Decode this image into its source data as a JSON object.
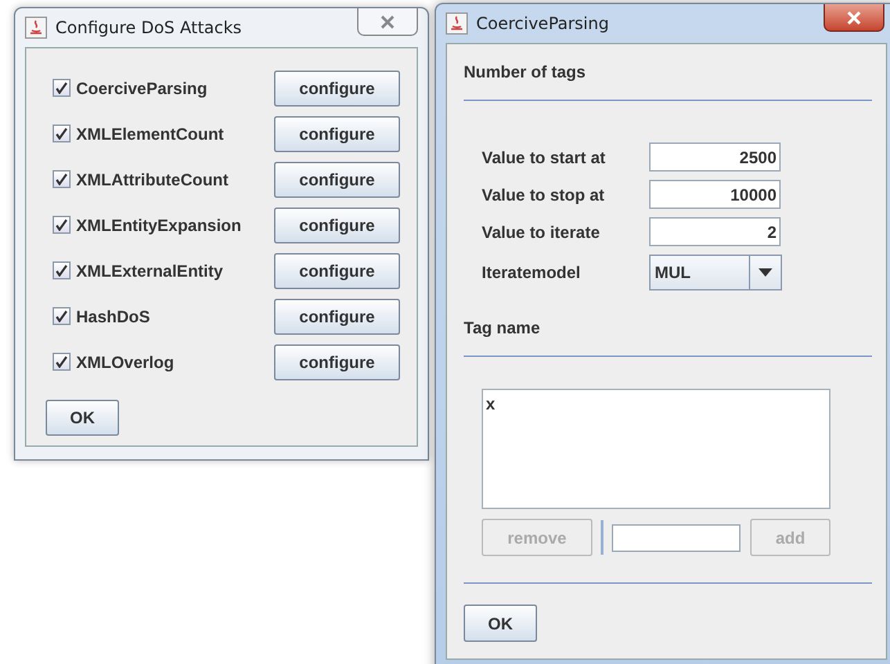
{
  "left_window": {
    "title": "Configure DoS Attacks",
    "attacks": [
      {
        "label": "CoerciveParsing",
        "checked": true,
        "button": "configure"
      },
      {
        "label": "XMLElementCount",
        "checked": true,
        "button": "configure"
      },
      {
        "label": "XMLAttributeCount",
        "checked": true,
        "button": "configure"
      },
      {
        "label": "XMLEntityExpansion",
        "checked": true,
        "button": "configure"
      },
      {
        "label": "XMLExternalEntity",
        "checked": true,
        "button": "configure"
      },
      {
        "label": "HashDoS",
        "checked": true,
        "button": "configure"
      },
      {
        "label": "XMLOverlog",
        "checked": true,
        "button": "configure"
      }
    ],
    "ok_button": "OK"
  },
  "right_window": {
    "title": "CoerciveParsing",
    "number_section": {
      "heading": "Number of tags",
      "fields": [
        {
          "label": "Value to start at",
          "value": "2500"
        },
        {
          "label": "Value to stop at",
          "value": "10000"
        },
        {
          "label": "Value to iterate",
          "value": "2"
        }
      ],
      "dropdown": {
        "label": "Iteratemodel",
        "value": "MUL"
      }
    },
    "tag_section": {
      "heading": "Tag name",
      "items": [
        "x"
      ],
      "remove_button": {
        "label": "remove",
        "disabled": true
      },
      "add_button": {
        "label": "add",
        "disabled": true
      }
    },
    "ok_button": "OK"
  }
}
